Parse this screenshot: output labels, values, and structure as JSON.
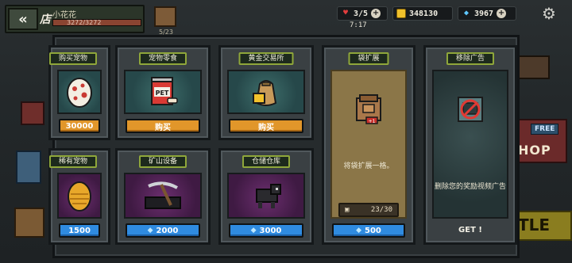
{
  "hud": {
    "shop_label": "店",
    "player_name": "小花花",
    "hp_text": "3272/3272",
    "hp_fraction": 1.0,
    "chest_count": "5/23",
    "hearts": "3/5",
    "coins": "348130",
    "gems": "3967",
    "timer": "7:17",
    "back_icon": "double-chevron-left",
    "settings_icon": "gear-icon"
  },
  "background": {
    "free_badge": "FREE",
    "shop_sign_partial": "HOP",
    "battle_partial": "TLE"
  },
  "cards": [
    {
      "id": "pets",
      "title": "购买宠物",
      "price": "30000",
      "currency": "coin",
      "button_color": "#e1962a"
    },
    {
      "id": "pet-food",
      "title": "宠物零食",
      "price_label": "购买",
      "button_color": "#e1962a"
    },
    {
      "id": "gold-exchange",
      "title": "黄金交易所",
      "price_label": "购买",
      "button_color": "#e1962a"
    },
    {
      "id": "bag-expand",
      "title": "袋扩展",
      "description": "将袋扩展一格。",
      "slots": "23/30",
      "price": "500",
      "currency": "gem",
      "button_color": "#2f8be0"
    },
    {
      "id": "remove-ads",
      "title": "移除广告",
      "description": "删除您的奖励视频广告",
      "get_label": "GET !"
    },
    {
      "id": "rare-pets",
      "title": "稀有宠物",
      "price": "1500",
      "currency": "gem",
      "button_color": "#2f8be0"
    },
    {
      "id": "mining-equipment",
      "title": "矿山设备",
      "price": "2000",
      "currency": "gem",
      "button_color": "#2f8be0"
    },
    {
      "id": "storage",
      "title": "仓储仓库",
      "price": "3000",
      "currency": "gem",
      "button_color": "#2f8be0"
    }
  ]
}
